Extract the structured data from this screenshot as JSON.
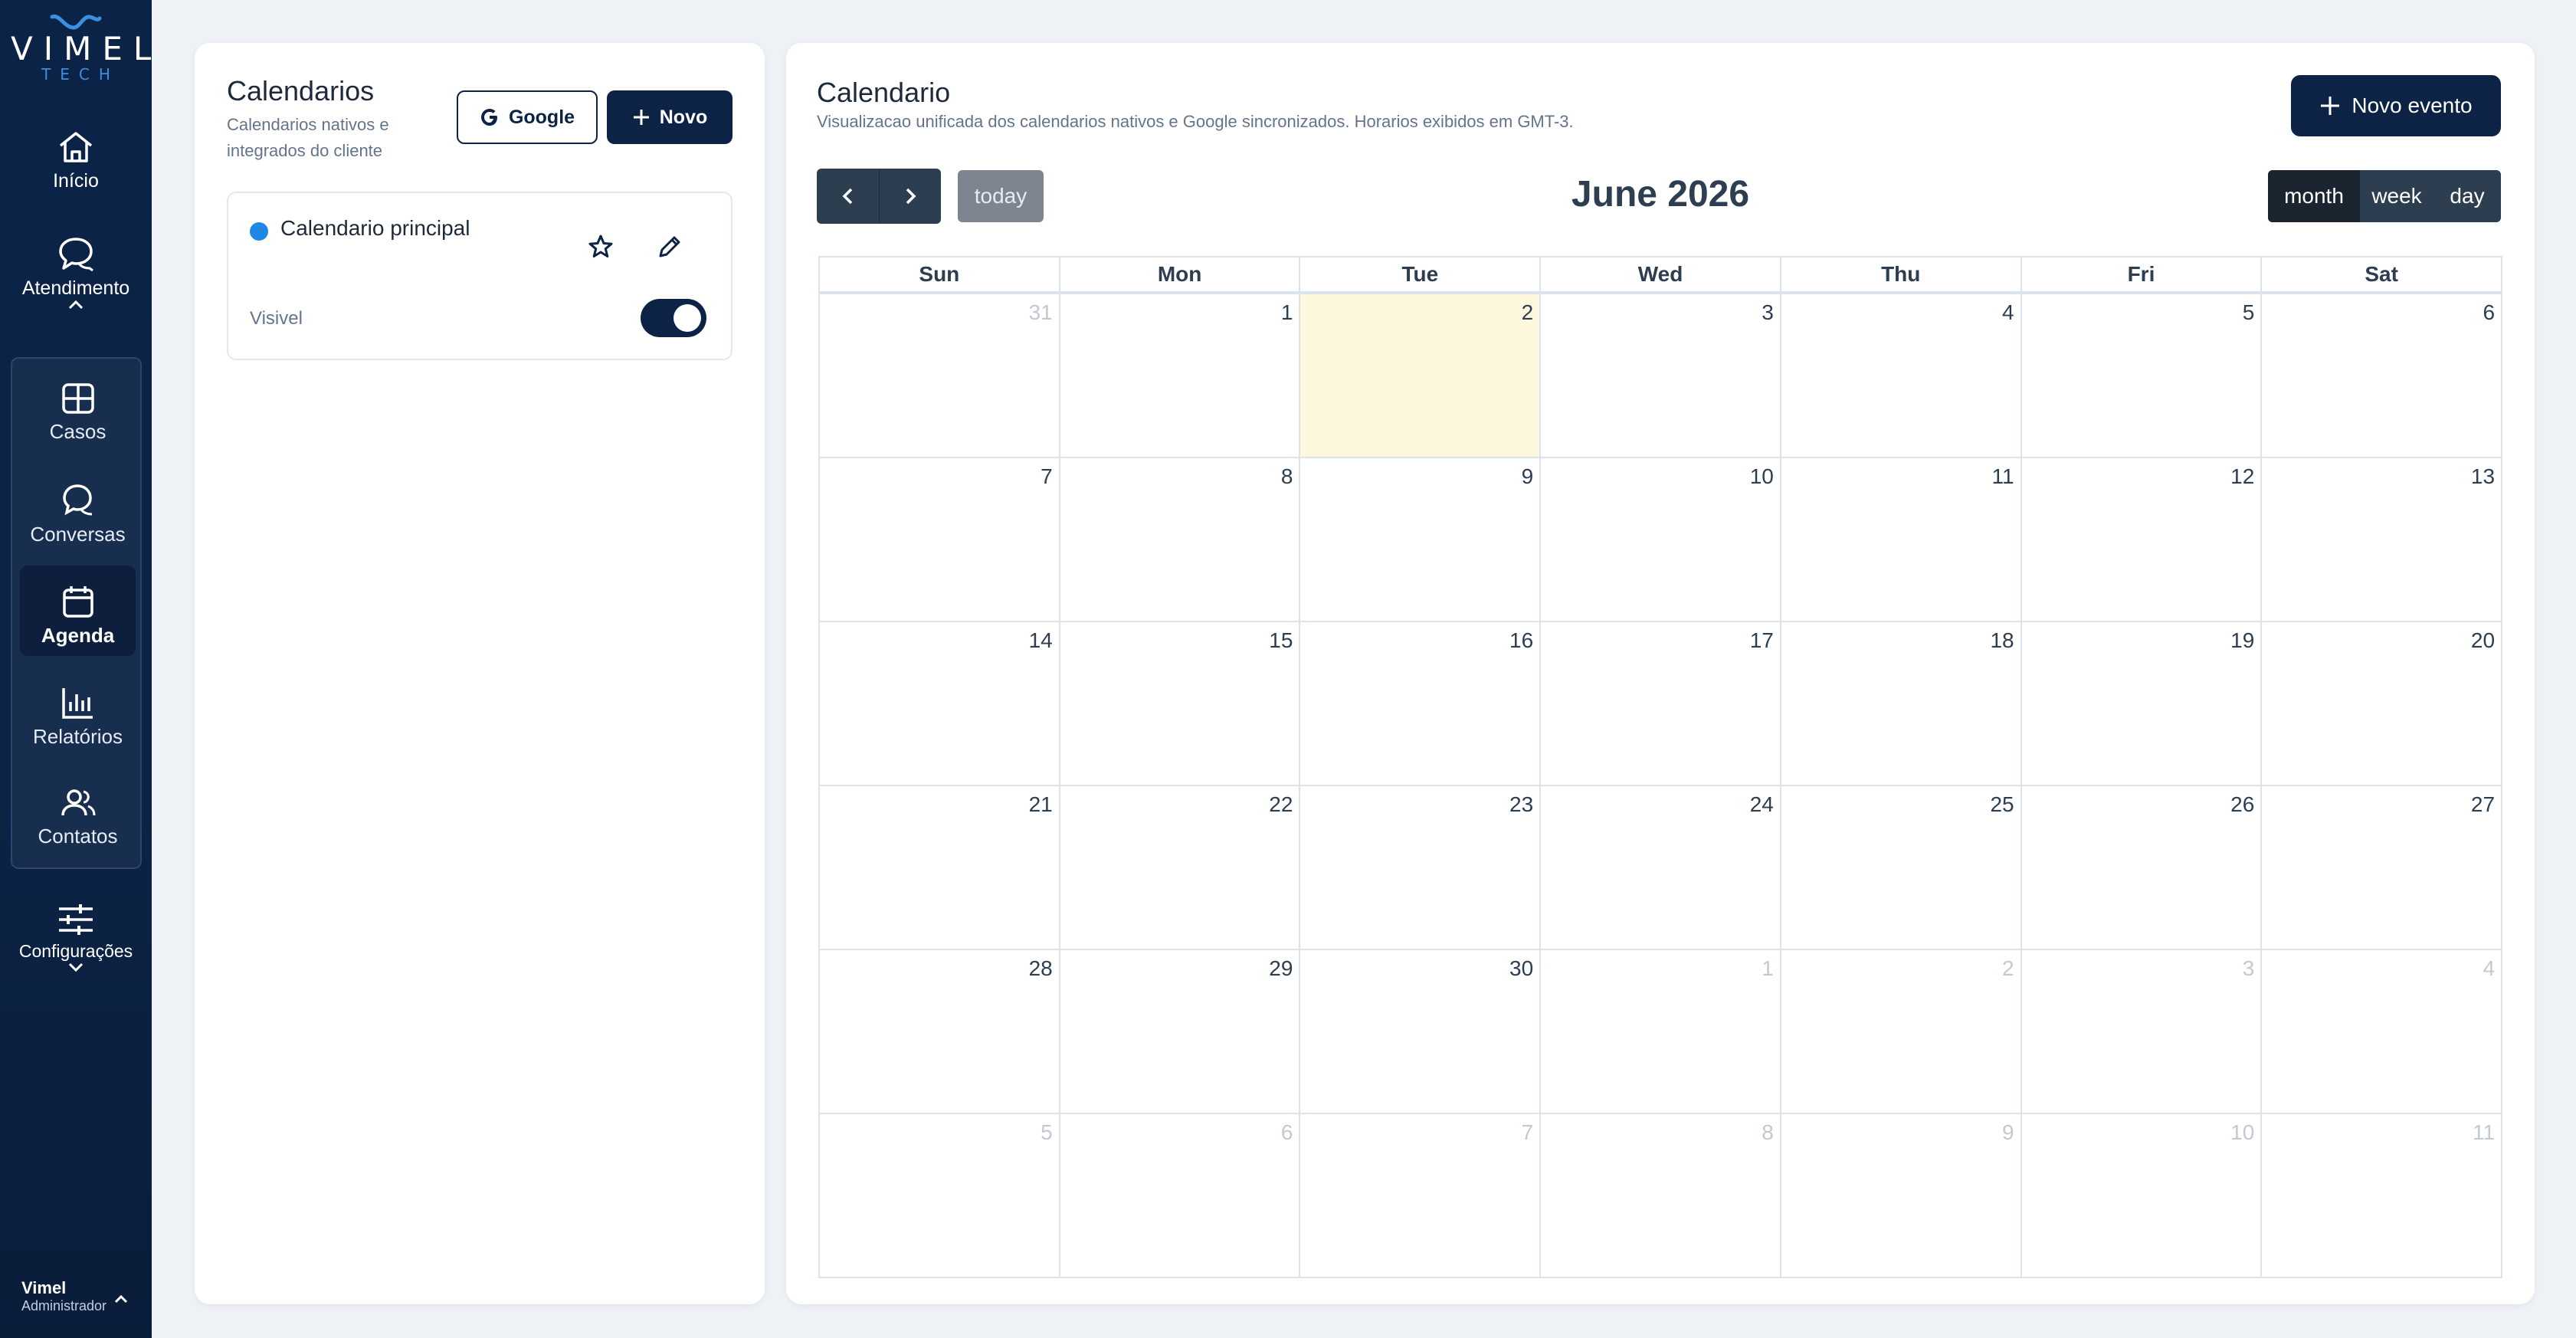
{
  "sidebar": {
    "brand": "VIMEL",
    "brand_sub": "TECH",
    "inicio": "Início",
    "atendimento": "Atendimento",
    "group": [
      {
        "label": "Casos",
        "icon": "grid-icon"
      },
      {
        "label": "Conversas",
        "icon": "chat-icon"
      },
      {
        "label": "Agenda",
        "icon": "calendar-icon",
        "active": true
      },
      {
        "label": "Relatórios",
        "icon": "bar-chart-icon"
      },
      {
        "label": "Contatos",
        "icon": "users-icon"
      }
    ],
    "configuracoes": "Configurações",
    "user_name": "Vimel",
    "user_role": "Administrador"
  },
  "calendars_panel": {
    "title": "Calendarios",
    "subtitle": "Calendarios nativos e integrados do cliente",
    "google_button": "Google",
    "new_button": "Novo",
    "item": {
      "name": "Calendario principal",
      "color": "#1e88e5",
      "visible_label": "Visivel",
      "visible": true
    }
  },
  "calendar": {
    "title": "Calendario",
    "subtitle": "Visualizacao unificada dos calendarios nativos e Google sincronizados. Horarios exibidos em GMT-3.",
    "new_event_button": "Novo evento",
    "today_button": "today",
    "month_title": "June 2026",
    "views": [
      "month",
      "week",
      "day"
    ],
    "active_view": "month",
    "weekdays": [
      "Sun",
      "Mon",
      "Tue",
      "Wed",
      "Thu",
      "Fri",
      "Sat"
    ],
    "weeks": [
      [
        "31",
        "1",
        "2",
        "3",
        "4",
        "5",
        "6"
      ],
      [
        "7",
        "8",
        "9",
        "10",
        "11",
        "12",
        "13"
      ],
      [
        "14",
        "15",
        "16",
        "17",
        "18",
        "19",
        "20"
      ],
      [
        "21",
        "22",
        "23",
        "24",
        "25",
        "26",
        "27"
      ],
      [
        "28",
        "29",
        "30",
        "1",
        "2",
        "3",
        "4"
      ],
      [
        "5",
        "6",
        "7",
        "8",
        "9",
        "10",
        "11"
      ]
    ],
    "other_month": [
      [
        true,
        false,
        false,
        false,
        false,
        false,
        false
      ],
      [
        false,
        false,
        false,
        false,
        false,
        false,
        false
      ],
      [
        false,
        false,
        false,
        false,
        false,
        false,
        false
      ],
      [
        false,
        false,
        false,
        false,
        false,
        false,
        false
      ],
      [
        false,
        false,
        false,
        true,
        true,
        true,
        true
      ],
      [
        true,
        true,
        true,
        true,
        true,
        true,
        true
      ]
    ],
    "today_cell": {
      "week": 0,
      "day": 2
    }
  },
  "colors": {
    "navy": "#0c2345",
    "toolbar": "#2c3e50",
    "today_bg": "#fdf8dd"
  }
}
